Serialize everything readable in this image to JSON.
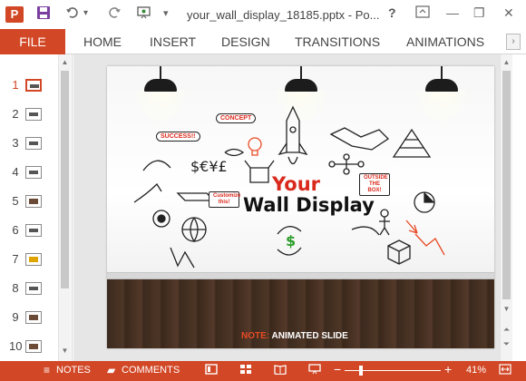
{
  "titlebar": {
    "app_icon_letter": "P",
    "title": "your_wall_display_18185.pptx - Po...",
    "help": "?",
    "minimize": "—",
    "restore": "❐",
    "close": "✕",
    "save_icon": "save-icon",
    "undo_icon": "undo-icon",
    "redo_icon": "redo-icon"
  },
  "ribbon": {
    "file": "FILE",
    "tabs": [
      "HOME",
      "INSERT",
      "DESIGN",
      "TRANSITIONS",
      "ANIMATIONS"
    ],
    "scroll": "›"
  },
  "thumbnails": {
    "numbers": [
      "1",
      "2",
      "3",
      "4",
      "5",
      "6",
      "7",
      "8",
      "9",
      "10"
    ],
    "active_index": 0
  },
  "slide": {
    "title_line1": "Your",
    "title_line2": "Wall Display",
    "bubbles": {
      "concept": "CONCEPT",
      "success": "SUCCESS!!",
      "customize": "Customize this!",
      "outside": "OUTSIDE THE BOX!"
    },
    "note_key": "NOTE:",
    "note_text": " ANIMATED SLIDE"
  },
  "statusbar": {
    "notes": "NOTES",
    "comments": "COMMENTS",
    "zoom_minus": "−",
    "zoom_plus": "+",
    "zoom_level": "41%",
    "zoom_fraction": 0.41
  },
  "colors": {
    "accent": "#d24726",
    "title_red": "#d9291c"
  }
}
